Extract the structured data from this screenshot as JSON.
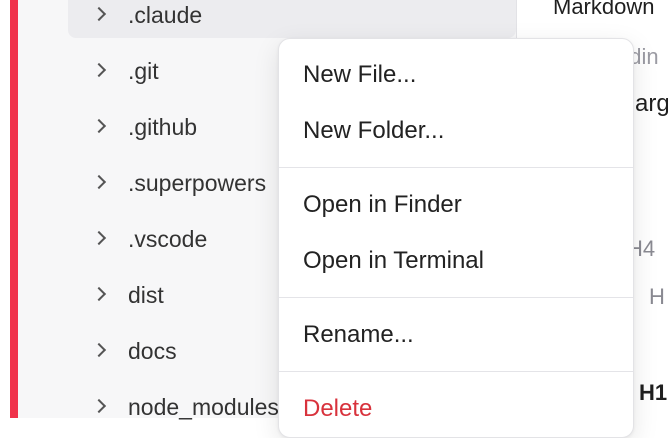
{
  "file_tree": {
    "items": [
      {
        "label": ".claude",
        "selected": true
      },
      {
        "label": ".git"
      },
      {
        "label": ".github"
      },
      {
        "label": ".superpowers"
      },
      {
        "label": ".vscode"
      },
      {
        "label": "dist"
      },
      {
        "label": "docs"
      },
      {
        "label": "node_modules"
      }
    ]
  },
  "context_menu": {
    "new_file": "New File...",
    "new_folder": "New Folder...",
    "open_in_finder": "Open in Finder",
    "open_in_terminal": "Open in Terminal",
    "rename": "Rename...",
    "delete": "Delete"
  },
  "right_panel": {
    "title": "Markdown",
    "subtitle": "adin",
    "large_text": "arg",
    "h4_label": "H4",
    "h_label": "H",
    "h1_label": "H1"
  },
  "colors": {
    "accent": "#f0324b",
    "danger": "#d8323c"
  }
}
